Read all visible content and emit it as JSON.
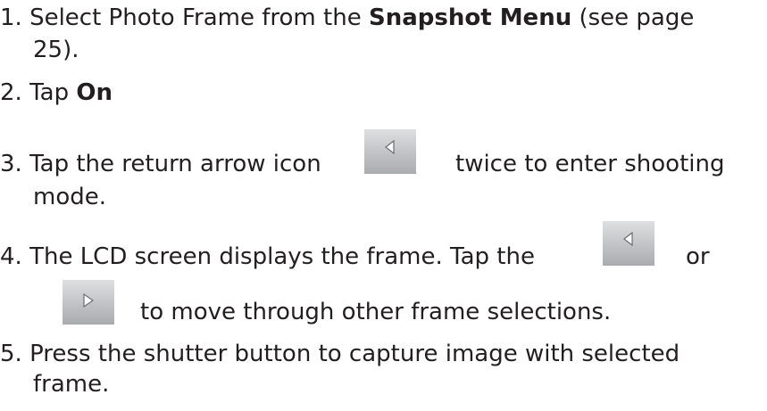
{
  "steps": [
    {
      "num": "1.",
      "text_a": "Select Photo Frame from the ",
      "bold": "Snapshot Menu",
      "text_b": " (see page",
      "cont": "25)."
    },
    {
      "num": "2.",
      "text_a": "Tap ",
      "bold": "On"
    },
    {
      "num": "3.",
      "text_a": "Tap the return arrow icon",
      "text_b": "twice to enter shooting",
      "cont": "mode."
    },
    {
      "num": "4.",
      "text_a": "The LCD screen displays the frame. Tap the",
      "text_b": "or",
      "cont": "to move through other frame selections."
    },
    {
      "num": "5.",
      "text_a": "Press the shutter button to capture image with selected",
      "cont": "frame."
    }
  ],
  "icons": {
    "left": "left-arrow-icon",
    "right": "right-arrow-icon"
  }
}
